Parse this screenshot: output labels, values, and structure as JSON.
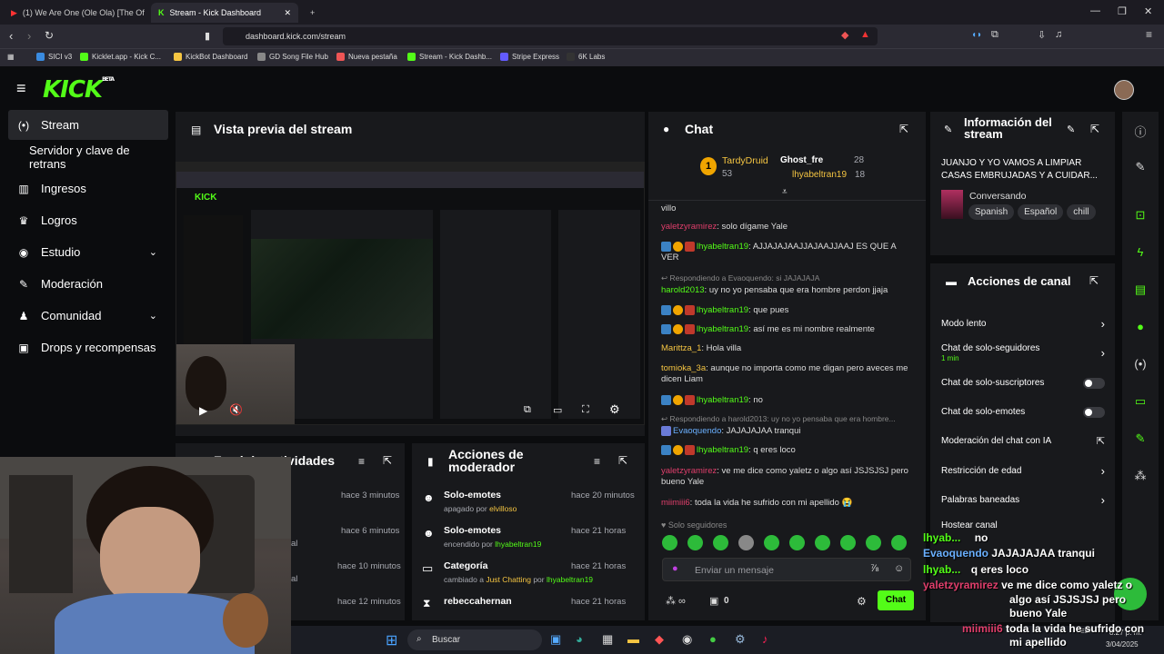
{
  "browser": {
    "tabs": [
      {
        "title": "(1) We Are One (Ole Ola) [The Of"
      },
      {
        "title": "Stream - Kick Dashboard"
      }
    ],
    "url": "dashboard.kick.com/stream",
    "bookmarks": [
      "SICI v3",
      "Kicklet.app - Kick C...",
      "KickBot Dashboard",
      "GD Song File Hub",
      "Nueva pestaña",
      "Stream - Kick Dashb...",
      "Stripe Express",
      "6K Labs"
    ]
  },
  "header": {
    "logo": "KICK",
    "logo_badge": "BETA"
  },
  "sidebar": {
    "items": [
      {
        "label": "Stream"
      },
      {
        "label": "Servidor y clave de retrans"
      },
      {
        "label": "Ingresos"
      },
      {
        "label": "Logros"
      },
      {
        "label": "Estudio"
      },
      {
        "label": "Moderación"
      },
      {
        "label": "Comunidad"
      },
      {
        "label": "Drops y recompensas"
      }
    ]
  },
  "preview": {
    "title": "Vista previa del stream"
  },
  "activity": {
    "title": "Feed de actividades",
    "times": [
      "hace 3 minutos",
      "hace 6 minutos",
      "hace 10 minutos",
      "hace 12 minutos"
    ],
    "fragments": [
      "al",
      "al"
    ]
  },
  "modactions": {
    "title": "Acciones de moderador",
    "items": [
      {
        "action": "Solo-emotes",
        "detail": "apagado por",
        "user": "elvilloso",
        "time": "hace 20 minutos"
      },
      {
        "action": "Solo-emotes",
        "detail": "encendido por",
        "user": "lhyabeltran19",
        "time": "hace 21 horas"
      },
      {
        "action": "Categoría",
        "detail": "cambiado a",
        "category": "Just Chatting",
        "by": "por",
        "user": "lhyabeltran19",
        "time": "hace 21 horas"
      },
      {
        "action": "rebeccahernan",
        "detail": "",
        "user": "",
        "time": "hace 21 horas"
      }
    ]
  },
  "chat": {
    "title": "Chat",
    "gifters": [
      {
        "name": "TardyDruid",
        "count": "53"
      },
      {
        "name": "Ghost_fre",
        "count": "28"
      },
      {
        "name": "lhyabeltran19",
        "count": "18"
      }
    ],
    "messages": [
      {
        "user": "",
        "text": "villo"
      },
      {
        "user": "yaletzyramirez",
        "text": "solo dígame Yale"
      },
      {
        "user": "lhyabeltran19",
        "text": "AJJAJAJAAJJAJAAJJAAJ ES QUE A VER"
      },
      {
        "reply": "Respondiendo a Evaoquendo: si JAJAJAJA"
      },
      {
        "user": "harold2013",
        "text": "uy no yo pensaba que era hombre perdon jjaja"
      },
      {
        "user": "lhyabeltran19",
        "text": "que pues"
      },
      {
        "user": "lhyabeltran19",
        "text": "así me es mi nombre realmente"
      },
      {
        "user": "Marittza_1",
        "text": "Hola villa"
      },
      {
        "user": "tomioka_3a",
        "text": "aunque no importa como me digan pero aveces me dicen Liam"
      },
      {
        "user": "lhyabeltran19",
        "text": "no"
      },
      {
        "reply": "Respondiendo a harold2013: uy no yo pensaba que era hombre..."
      },
      {
        "user": "Evaoquendo",
        "text": "JAJAJAJAA tranqui"
      },
      {
        "user": "lhyabeltran19",
        "text": "q eres loco"
      },
      {
        "user": "yaletzyramirez",
        "text": "ve me dice como yaletz o algo así JSJSJSJ pero bueno Yale"
      },
      {
        "user": "miimiii6",
        "text": "toda la vida he sufrido con mi apellido 😭"
      }
    ],
    "followers_only": "Solo seguidores",
    "input_placeholder": "Enviar un mensaje",
    "counter": "0",
    "send_label": "Chat"
  },
  "info": {
    "title": "Información del stream",
    "stream_title": "JUANJO Y YO VAMOS A LIMPIAR CASAS EMBRUJADAS Y A CUIDAR...",
    "category": "Conversando",
    "tags": [
      "Spanish",
      "Español",
      "chill"
    ]
  },
  "channel_actions": {
    "title": "Acciones de canal",
    "items": [
      {
        "label": "Modo lento",
        "kind": "arrow"
      },
      {
        "label": "Chat de solo-seguidores",
        "sub": "1 min",
        "kind": "arrow"
      },
      {
        "label": "Chat de solo-suscriptores",
        "kind": "toggle"
      },
      {
        "label": "Chat de solo-emotes",
        "kind": "toggle"
      },
      {
        "label": "Moderación del chat con IA",
        "kind": "link"
      },
      {
        "label": "Restricción de edad",
        "kind": "arrow"
      },
      {
        "label": "Palabras baneadas",
        "kind": "arrow"
      },
      {
        "label": "Hostear canal",
        "kind": "arrow"
      }
    ]
  },
  "overlay": {
    "lines": [
      {
        "user": "lhyab...",
        "text": "no"
      },
      {
        "user": "Evaoquendo",
        "text": "JAJAJAJAA tranqui"
      },
      {
        "user": "lhyab...",
        "text": "q eres loco"
      },
      {
        "user": "yaletzyramirez",
        "text": "ve me dice como yaletz o"
      },
      {
        "user": "",
        "text": "algo así JSJSJSJ pero"
      },
      {
        "user": "",
        "text": "bueno Yale"
      },
      {
        "user": "miimiii6",
        "text": "toda la vida he sufrido con"
      },
      {
        "user": "",
        "text": "mi apellido"
      }
    ]
  },
  "taskbar": {
    "search": "Buscar",
    "lang": "ESP",
    "time": "8:27 p. m.",
    "date": "3/04/2025"
  },
  "colors": {
    "accent": "#53fc18",
    "panel": "#18191c",
    "bg": "#0b0c0e"
  }
}
